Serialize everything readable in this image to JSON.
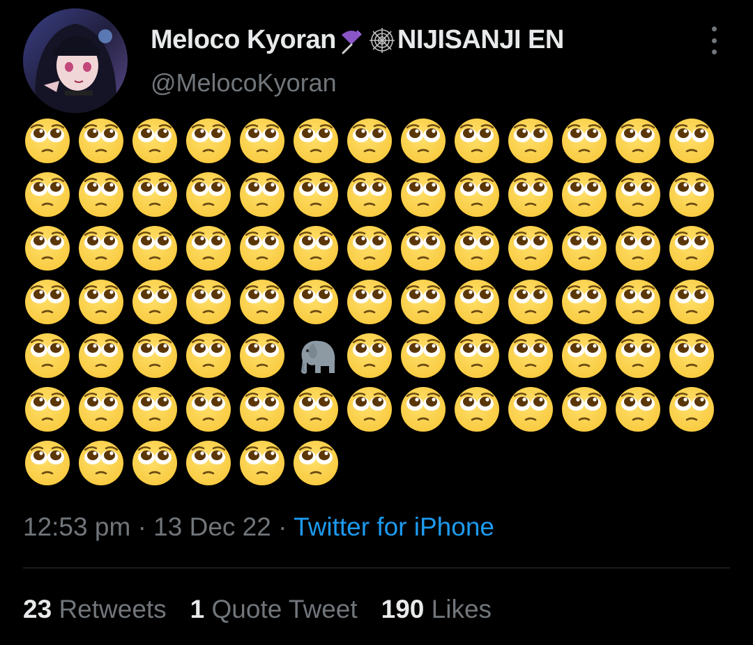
{
  "tweet": {
    "author": {
      "display_name_first": "Meloco Kyoran",
      "display_name_emoji_1": "umbrella-icon",
      "display_name_emoji_2": "spider-web-icon",
      "display_name_last": "NIJISANJI EN",
      "handle": "@MelocoKyoran",
      "avatar": "avatar-image"
    },
    "body": {
      "emoji_columns": 13,
      "emoji_count": 84,
      "emojis": [
        "pleading-face",
        "pleading-face",
        "pleading-face",
        "pleading-face",
        "pleading-face",
        "pleading-face",
        "pleading-face",
        "pleading-face",
        "pleading-face",
        "pleading-face",
        "pleading-face",
        "pleading-face",
        "pleading-face",
        "pleading-face",
        "pleading-face",
        "pleading-face",
        "pleading-face",
        "pleading-face",
        "pleading-face",
        "pleading-face",
        "pleading-face",
        "pleading-face",
        "pleading-face",
        "pleading-face",
        "pleading-face",
        "pleading-face",
        "pleading-face",
        "pleading-face",
        "pleading-face",
        "pleading-face",
        "pleading-face",
        "pleading-face",
        "pleading-face",
        "pleading-face",
        "pleading-face",
        "pleading-face",
        "pleading-face",
        "pleading-face",
        "pleading-face",
        "pleading-face",
        "pleading-face",
        "pleading-face",
        "pleading-face",
        "pleading-face",
        "pleading-face",
        "pleading-face",
        "pleading-face",
        "pleading-face",
        "pleading-face",
        "pleading-face",
        "pleading-face",
        "pleading-face",
        "pleading-face",
        "pleading-face",
        "pleading-face",
        "pleading-face",
        "pleading-face",
        "elephant",
        "pleading-face",
        "pleading-face",
        "pleading-face",
        "pleading-face",
        "pleading-face",
        "pleading-face",
        "pleading-face",
        "pleading-face",
        "pleading-face",
        "pleading-face",
        "pleading-face",
        "pleading-face",
        "pleading-face",
        "pleading-face",
        "pleading-face",
        "pleading-face",
        "pleading-face",
        "pleading-face",
        "pleading-face",
        "pleading-face",
        "pleading-face",
        "pleading-face",
        "pleading-face",
        "pleading-face",
        "pleading-face",
        "pleading-face"
      ]
    },
    "meta": {
      "time": "12:53 pm",
      "separator": "·",
      "date": "13 Dec 22",
      "source": "Twitter for iPhone"
    },
    "stats": {
      "retweets_count": "23",
      "retweets_label": "Retweets",
      "quotes_count": "1",
      "quotes_label": "Quote Tweet",
      "likes_count": "190",
      "likes_label": "Likes"
    },
    "more_icon": "more-vertical-icon"
  },
  "colors": {
    "background": "#000000",
    "primary_text": "#e7e9ea",
    "secondary_text": "#71767b",
    "link": "#1d9bf0",
    "divider": "#2f3336",
    "emoji_face": "#f8c93e"
  }
}
